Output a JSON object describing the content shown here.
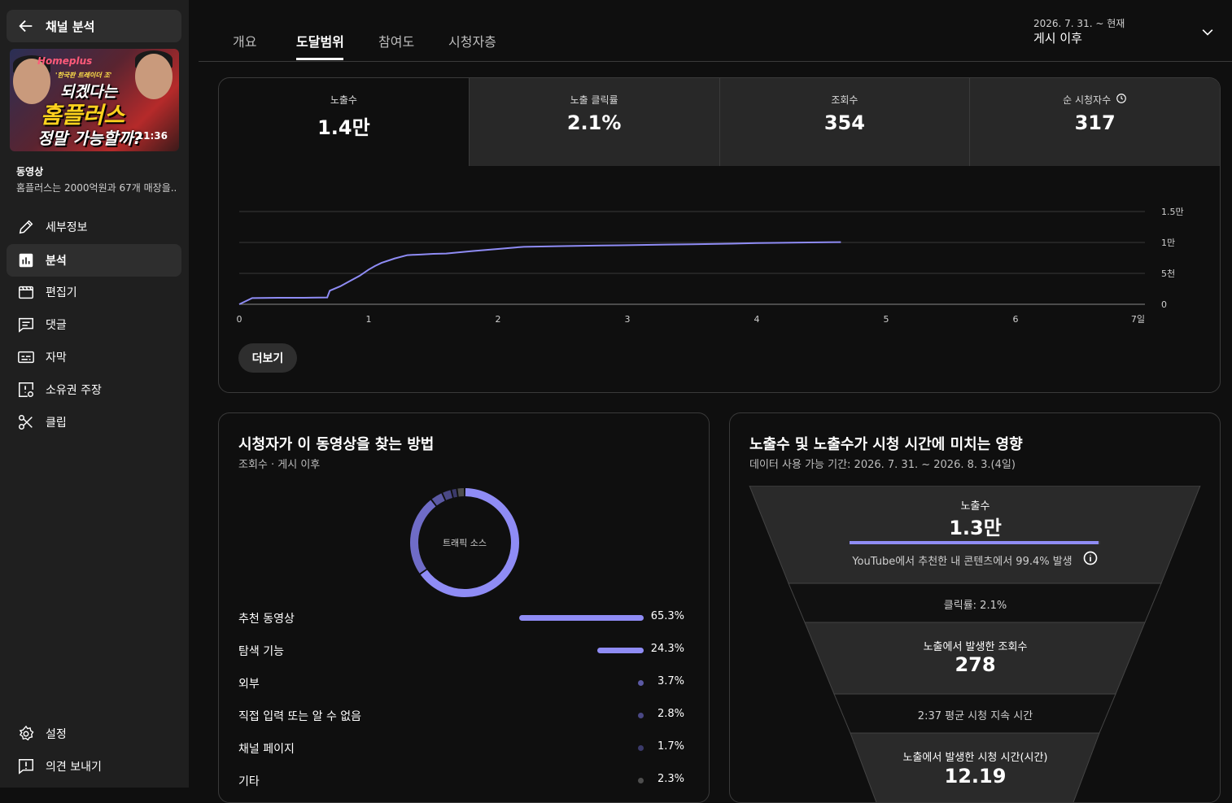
{
  "sidebar": {
    "header_title": "채널 분석",
    "thumbnail": {
      "brand": "Homeplus",
      "subtitle": "'한국판 트레이더 조'",
      "line1": "되겠다는",
      "line2": "홈플러스",
      "line3": "정말 가능할까?",
      "duration": "11:36"
    },
    "video_label": "동영상",
    "video_title": "홈플러스는 2000억원과 67개 매장을...",
    "nav": [
      {
        "label": "세부정보",
        "icon": "pencil-icon"
      },
      {
        "label": "분석",
        "icon": "analytics-icon"
      },
      {
        "label": "편집기",
        "icon": "clapperboard-icon"
      },
      {
        "label": "댓글",
        "icon": "comment-icon"
      },
      {
        "label": "자막",
        "icon": "subtitles-icon"
      },
      {
        "label": "소유권 주장",
        "icon": "copyright-claim-icon"
      },
      {
        "label": "클립",
        "icon": "scissors-icon"
      }
    ],
    "bottom_nav": [
      {
        "label": "설정",
        "icon": "gear-icon"
      },
      {
        "label": "의견 보내기",
        "icon": "feedback-icon"
      }
    ]
  },
  "tabs": [
    "개요",
    "도달범위",
    "참여도",
    "시청자층"
  ],
  "active_tab": "도달범위",
  "date_range": {
    "range": "2026. 7. 31. ~ 현재",
    "label": "게시 이후"
  },
  "metrics": [
    {
      "label": "노출수",
      "value": "1.4만"
    },
    {
      "label": "노출 클릭률",
      "value": "2.1%"
    },
    {
      "label": "조회수",
      "value": "354"
    },
    {
      "label": "순 시청자수",
      "value": "317"
    }
  ],
  "chart_data": {
    "type": "line",
    "x": [
      0,
      0.1,
      0.3,
      0.5,
      0.68,
      0.7,
      0.78,
      0.85,
      0.93,
      1.0,
      1.05,
      1.1,
      1.2,
      1.3,
      1.4,
      1.5,
      1.6,
      1.8,
      2.0,
      2.2,
      2.5,
      2.8,
      3.0,
      3.3,
      3.5,
      3.8,
      4.0,
      4.2,
      4.4,
      4.65
    ],
    "y": [
      0,
      1000,
      1050,
      1050,
      1100,
      2200,
      2900,
      3700,
      4600,
      5600,
      6200,
      6700,
      7400,
      7950,
      8050,
      8150,
      8200,
      8600,
      8950,
      9300,
      9400,
      9500,
      9550,
      9650,
      9700,
      9800,
      9900,
      9950,
      10000,
      10050
    ],
    "xticks": [
      "0",
      "1",
      "2",
      "3",
      "4",
      "5",
      "6",
      "7일"
    ],
    "yticks": [
      "0",
      "5천",
      "1만",
      "1.5만"
    ],
    "xlim": [
      0,
      7
    ],
    "ylim": [
      0,
      15000
    ],
    "color": "#8f8cf5",
    "grid": true
  },
  "more_button": "더보기",
  "traffic": {
    "title": "시청자가 이 동영상을 찾는 방법",
    "subtitle": "조회수 · 게시 이후",
    "donut_label": "트래픽 소스",
    "sources": [
      {
        "label": "추천 동영상",
        "value": "65.3%",
        "pct": 65.3,
        "color": "#8f8cf5"
      },
      {
        "label": "탐색 기능",
        "value": "24.3%",
        "pct": 24.3,
        "color": "#6f6cc7"
      },
      {
        "label": "외부",
        "value": "3.7%",
        "pct": 3.7,
        "color": "#5b59a4"
      },
      {
        "label": "직접 입력 또는 알 수 없음",
        "value": "2.8%",
        "pct": 2.8,
        "color": "#4a4885"
      },
      {
        "label": "채널 페이지",
        "value": "1.7%",
        "pct": 1.7,
        "color": "#3b3a6a"
      },
      {
        "label": "기타",
        "value": "2.3%",
        "pct": 2.3,
        "color": "#4e4e4e"
      }
    ]
  },
  "funnel": {
    "title": "노출수 및 노출수가 시청 시간에 미치는 영향",
    "subtitle": "데이터 사용 가능 기간: 2026. 7. 31. ~ 2026. 8. 3.(4일)",
    "impressions_label": "노출수",
    "impressions_value": "1.3만",
    "impressions_bar_pct": 99.4,
    "impressions_note": "YouTube에서 추천한 내 콘텐츠에서 99.4% 발생",
    "ctr": "클릭률: 2.1%",
    "views_label": "노출에서 발생한 조회수",
    "views_value": "278",
    "avg_duration": "2:37 평균 시청 지속 시간",
    "watch_label": "노출에서 발생한 시청 시간(시간)",
    "watch_value": "12.19"
  }
}
